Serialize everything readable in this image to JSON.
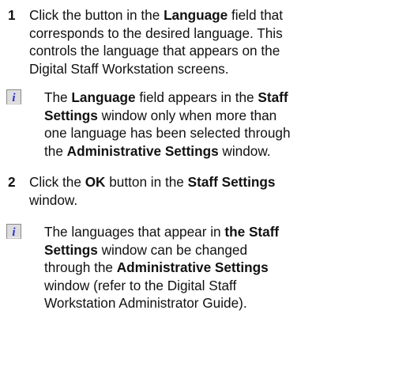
{
  "step1": {
    "number": "1",
    "lines": [
      [
        "Click the button in the ",
        "Language",
        " field that"
      ],
      [
        "corresponds to the desired language.  This"
      ],
      [
        "controls the language that appears on the"
      ],
      [
        "Digital Staff Workstation screens."
      ]
    ]
  },
  "note1": {
    "icon": "info-icon",
    "lines": [
      [
        "The ",
        "Language",
        " field appears in the ",
        "Staff"
      ],
      [
        "Settings",
        " window only when more than"
      ],
      [
        "one language has been selected through"
      ],
      [
        "the ",
        "Administrative Settings",
        " window."
      ]
    ]
  },
  "step2": {
    "number": "2",
    "lines": [
      [
        "Click the ",
        "OK",
        " button in the ",
        "Staff Settings"
      ],
      [
        "window."
      ]
    ]
  },
  "note2": {
    "icon": "info-icon",
    "lines": [
      [
        "The languages that appear in ",
        "the Staff"
      ],
      [
        "Settings",
        " window can be changed"
      ],
      [
        "through the ",
        "Administrative Settings"
      ],
      [
        "window (refer to the Digital Staff"
      ],
      [
        "Workstation Administrator Guide)."
      ]
    ]
  },
  "colors": {
    "icon_bg": "#dcdcdc",
    "icon_border": "#8a8a8a",
    "icon_glyph": "#2b2bd8"
  }
}
